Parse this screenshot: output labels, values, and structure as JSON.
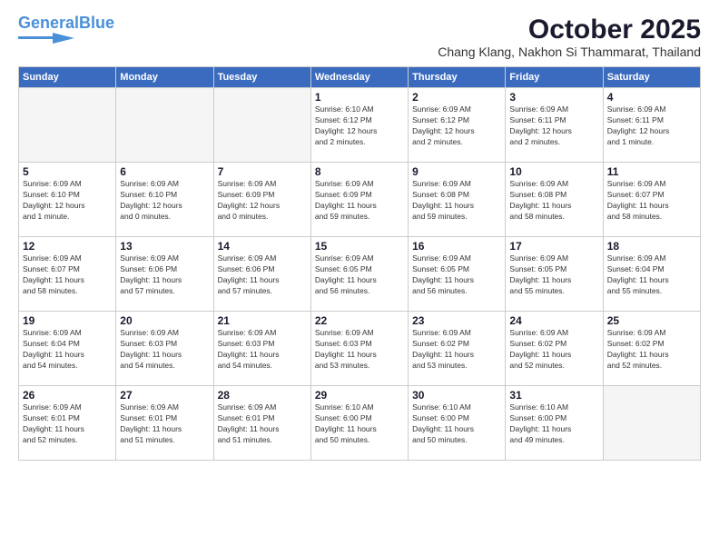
{
  "logo": {
    "general": "General",
    "blue": "Blue"
  },
  "title": "October 2025",
  "subtitle": "Chang Klang, Nakhon Si Thammarat, Thailand",
  "headers": [
    "Sunday",
    "Monday",
    "Tuesday",
    "Wednesday",
    "Thursday",
    "Friday",
    "Saturday"
  ],
  "weeks": [
    [
      {
        "day": "",
        "info": ""
      },
      {
        "day": "",
        "info": ""
      },
      {
        "day": "",
        "info": ""
      },
      {
        "day": "1",
        "info": "Sunrise: 6:10 AM\nSunset: 6:12 PM\nDaylight: 12 hours\nand 2 minutes."
      },
      {
        "day": "2",
        "info": "Sunrise: 6:09 AM\nSunset: 6:12 PM\nDaylight: 12 hours\nand 2 minutes."
      },
      {
        "day": "3",
        "info": "Sunrise: 6:09 AM\nSunset: 6:11 PM\nDaylight: 12 hours\nand 2 minutes."
      },
      {
        "day": "4",
        "info": "Sunrise: 6:09 AM\nSunset: 6:11 PM\nDaylight: 12 hours\nand 1 minute."
      }
    ],
    [
      {
        "day": "5",
        "info": "Sunrise: 6:09 AM\nSunset: 6:10 PM\nDaylight: 12 hours\nand 1 minute."
      },
      {
        "day": "6",
        "info": "Sunrise: 6:09 AM\nSunset: 6:10 PM\nDaylight: 12 hours\nand 0 minutes."
      },
      {
        "day": "7",
        "info": "Sunrise: 6:09 AM\nSunset: 6:09 PM\nDaylight: 12 hours\nand 0 minutes."
      },
      {
        "day": "8",
        "info": "Sunrise: 6:09 AM\nSunset: 6:09 PM\nDaylight: 11 hours\nand 59 minutes."
      },
      {
        "day": "9",
        "info": "Sunrise: 6:09 AM\nSunset: 6:08 PM\nDaylight: 11 hours\nand 59 minutes."
      },
      {
        "day": "10",
        "info": "Sunrise: 6:09 AM\nSunset: 6:08 PM\nDaylight: 11 hours\nand 58 minutes."
      },
      {
        "day": "11",
        "info": "Sunrise: 6:09 AM\nSunset: 6:07 PM\nDaylight: 11 hours\nand 58 minutes."
      }
    ],
    [
      {
        "day": "12",
        "info": "Sunrise: 6:09 AM\nSunset: 6:07 PM\nDaylight: 11 hours\nand 58 minutes."
      },
      {
        "day": "13",
        "info": "Sunrise: 6:09 AM\nSunset: 6:06 PM\nDaylight: 11 hours\nand 57 minutes."
      },
      {
        "day": "14",
        "info": "Sunrise: 6:09 AM\nSunset: 6:06 PM\nDaylight: 11 hours\nand 57 minutes."
      },
      {
        "day": "15",
        "info": "Sunrise: 6:09 AM\nSunset: 6:05 PM\nDaylight: 11 hours\nand 56 minutes."
      },
      {
        "day": "16",
        "info": "Sunrise: 6:09 AM\nSunset: 6:05 PM\nDaylight: 11 hours\nand 56 minutes."
      },
      {
        "day": "17",
        "info": "Sunrise: 6:09 AM\nSunset: 6:05 PM\nDaylight: 11 hours\nand 55 minutes."
      },
      {
        "day": "18",
        "info": "Sunrise: 6:09 AM\nSunset: 6:04 PM\nDaylight: 11 hours\nand 55 minutes."
      }
    ],
    [
      {
        "day": "19",
        "info": "Sunrise: 6:09 AM\nSunset: 6:04 PM\nDaylight: 11 hours\nand 54 minutes."
      },
      {
        "day": "20",
        "info": "Sunrise: 6:09 AM\nSunset: 6:03 PM\nDaylight: 11 hours\nand 54 minutes."
      },
      {
        "day": "21",
        "info": "Sunrise: 6:09 AM\nSunset: 6:03 PM\nDaylight: 11 hours\nand 54 minutes."
      },
      {
        "day": "22",
        "info": "Sunrise: 6:09 AM\nSunset: 6:03 PM\nDaylight: 11 hours\nand 53 minutes."
      },
      {
        "day": "23",
        "info": "Sunrise: 6:09 AM\nSunset: 6:02 PM\nDaylight: 11 hours\nand 53 minutes."
      },
      {
        "day": "24",
        "info": "Sunrise: 6:09 AM\nSunset: 6:02 PM\nDaylight: 11 hours\nand 52 minutes."
      },
      {
        "day": "25",
        "info": "Sunrise: 6:09 AM\nSunset: 6:02 PM\nDaylight: 11 hours\nand 52 minutes."
      }
    ],
    [
      {
        "day": "26",
        "info": "Sunrise: 6:09 AM\nSunset: 6:01 PM\nDaylight: 11 hours\nand 52 minutes."
      },
      {
        "day": "27",
        "info": "Sunrise: 6:09 AM\nSunset: 6:01 PM\nDaylight: 11 hours\nand 51 minutes."
      },
      {
        "day": "28",
        "info": "Sunrise: 6:09 AM\nSunset: 6:01 PM\nDaylight: 11 hours\nand 51 minutes."
      },
      {
        "day": "29",
        "info": "Sunrise: 6:10 AM\nSunset: 6:00 PM\nDaylight: 11 hours\nand 50 minutes."
      },
      {
        "day": "30",
        "info": "Sunrise: 6:10 AM\nSunset: 6:00 PM\nDaylight: 11 hours\nand 50 minutes."
      },
      {
        "day": "31",
        "info": "Sunrise: 6:10 AM\nSunset: 6:00 PM\nDaylight: 11 hours\nand 49 minutes."
      },
      {
        "day": "",
        "info": ""
      }
    ]
  ]
}
